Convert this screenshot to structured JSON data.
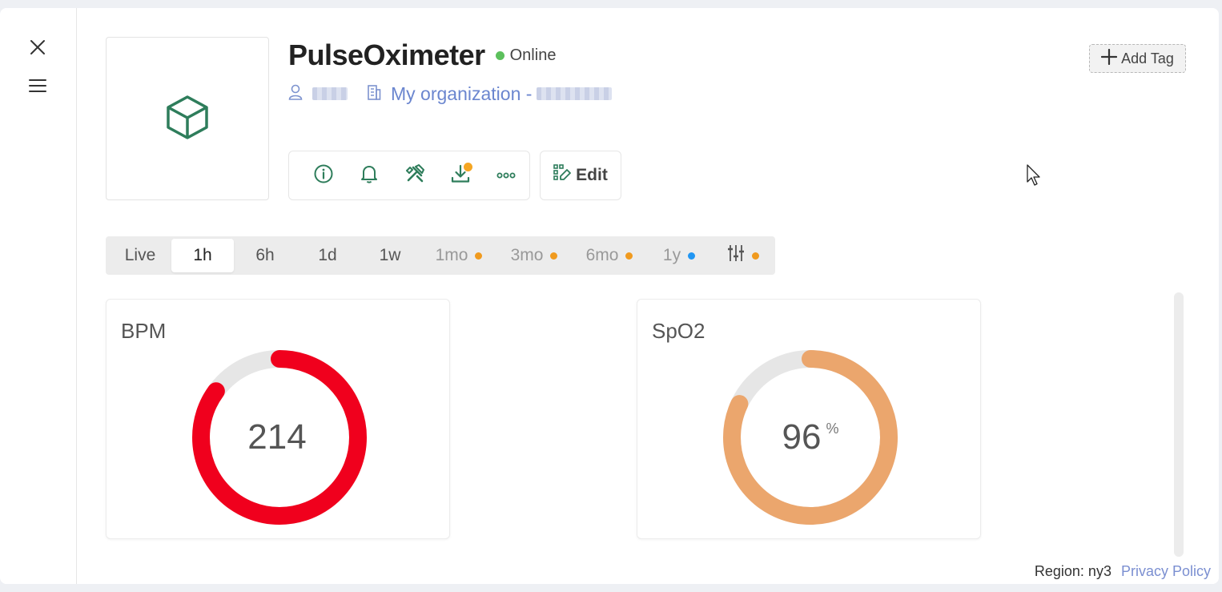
{
  "device": {
    "name": "PulseOximeter",
    "status": "Online",
    "status_color": "#5cc05c",
    "owner_icon": "user-icon",
    "organization_icon": "building-icon",
    "organization_label": "My organization -"
  },
  "toolbar": {
    "icons": [
      "info-icon",
      "bell-icon",
      "tools-icon",
      "download-icon",
      "more-icon"
    ],
    "download_badge_color": "#f5a623",
    "edit_label": "Edit"
  },
  "tag_button": {
    "label": "Add Tag"
  },
  "time_ranges": [
    {
      "label": "Live"
    },
    {
      "label": "1h",
      "active": true
    },
    {
      "label": "6h"
    },
    {
      "label": "1d"
    },
    {
      "label": "1w"
    },
    {
      "label": "1mo",
      "dot": "#f09a1e"
    },
    {
      "label": "3mo",
      "dot": "#f09a1e"
    },
    {
      "label": "6mo",
      "dot": "#f09a1e"
    },
    {
      "label": "1y",
      "dot": "#2196f3"
    },
    {
      "label": "",
      "icon": "sliders-icon",
      "dot": "#f09a1e"
    }
  ],
  "widgets": {
    "bpm": {
      "title": "BPM",
      "value": "214",
      "unit": "",
      "fill_fraction": 0.85,
      "color": "#f0001d",
      "track": "#e6e6e6"
    },
    "spo2": {
      "title": "SpO2",
      "value": "96",
      "unit": "%",
      "fill_fraction": 0.82,
      "color": "#eba66d",
      "track": "#e6e6e6"
    }
  },
  "footer": {
    "region": "Region: ny3",
    "privacy": "Privacy Policy"
  }
}
